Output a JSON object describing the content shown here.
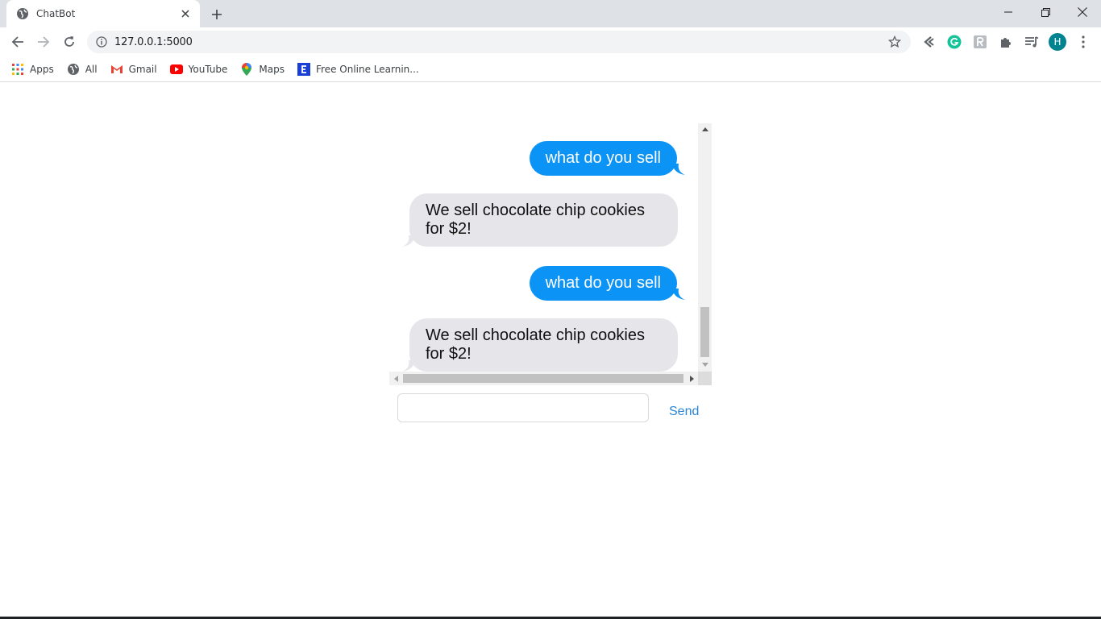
{
  "browser": {
    "tab_title": "ChatBot",
    "url": "127.0.0.1:5000",
    "avatar_initial": "H",
    "icons": {
      "tab_favicon": "globe-icon",
      "tab_close": "close-icon",
      "new_tab": "plus-icon",
      "back": "back-arrow-icon",
      "forward": "forward-arrow-icon",
      "reload": "reload-icon",
      "site_info": "info-icon",
      "bookmark_star": "star-icon",
      "extensions": [
        "back-icon-ext",
        "grammarly-icon",
        "ext-r-icon",
        "puzzle-icon",
        "media-queue-icon"
      ],
      "menu": "kebab-menu-icon"
    }
  },
  "bookmarks": [
    {
      "label": "Apps",
      "icon": "apps-grid-icon"
    },
    {
      "label": "All",
      "icon": "globe-icon"
    },
    {
      "label": "Gmail",
      "icon": "gmail-icon"
    },
    {
      "label": "YouTube",
      "icon": "youtube-icon"
    },
    {
      "label": "Maps",
      "icon": "maps-pin-icon"
    },
    {
      "label": "Free Online Learnin...",
      "icon": "learning-site-icon"
    }
  ],
  "chat": {
    "messages": [
      {
        "from": "user",
        "text": "what do you sell"
      },
      {
        "from": "bot",
        "text": "We sell chocolate chip cookies for $2!"
      },
      {
        "from": "user",
        "text": "what do you sell"
      },
      {
        "from": "bot",
        "text": "We sell chocolate chip cookies for $2!"
      }
    ],
    "input_value": "",
    "input_placeholder": "",
    "send_label": "Send"
  },
  "colors": {
    "sent_bubble": "#0b93f6",
    "received_bubble": "#e5e5ea",
    "send_link": "#2a86d6"
  }
}
